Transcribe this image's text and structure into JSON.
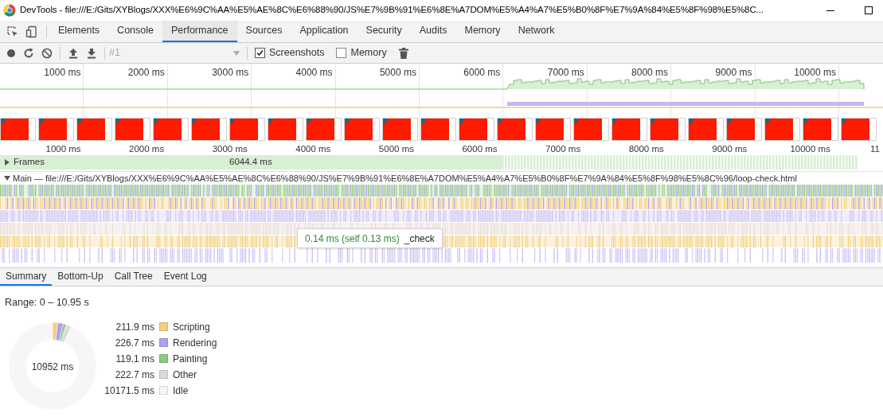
{
  "window": {
    "title": "DevTools - file:///E:/Gits/XYBlogs/XXX%E6%9C%AA%E5%AE%8C%E6%88%90/JS%E7%9B%91%E6%8E%A7DOM%E5%A4%A7%E5%B0%8F%E7%9A%84%E5%8F%98%E5%8C..."
  },
  "tabs": [
    {
      "label": "Elements",
      "selected": false
    },
    {
      "label": "Console",
      "selected": false
    },
    {
      "label": "Performance",
      "selected": true
    },
    {
      "label": "Sources",
      "selected": false
    },
    {
      "label": "Application",
      "selected": false
    },
    {
      "label": "Security",
      "selected": false
    },
    {
      "label": "Audits",
      "selected": false
    },
    {
      "label": "Memory",
      "selected": false
    },
    {
      "label": "Network",
      "selected": false
    }
  ],
  "toolbar": {
    "recording_select": {
      "placeholder": "#1"
    },
    "checkboxes": [
      {
        "label": "Screenshots",
        "checked": true
      },
      {
        "label": "Memory",
        "checked": false
      }
    ]
  },
  "overview": {
    "ticks": [
      "1000 ms",
      "2000 ms",
      "3000 ms",
      "4000 ms",
      "5000 ms",
      "6000 ms",
      "7000 ms",
      "8000 ms",
      "9000 ms",
      "10000 ms"
    ]
  },
  "ruler": {
    "ticks": [
      "1000 ms",
      "2000 ms",
      "3000 ms",
      "4000 ms",
      "5000 ms",
      "6000 ms",
      "7000 ms",
      "8000 ms",
      "9000 ms",
      "10000 ms"
    ],
    "cut_label": "11"
  },
  "frames": {
    "label": "Frames",
    "duration": "6044.4 ms",
    "expanded": false
  },
  "main": {
    "label": "Main — file:///E:/Gits/XYBlogs/XXX%E6%9C%AA%E5%AE%8C%E6%88%90/JS%E7%9B%91%E6%8E%A7DOM%E5%A4%A7%E5%B0%8F%E7%9A%84%E5%8F%98%E5%8C%96/loop-check.html",
    "expanded": true
  },
  "tooltip": {
    "duration": "0.14 ms (self 0.13 ms)",
    "name": "_check"
  },
  "details_tabs": [
    {
      "label": "Summary",
      "selected": true
    },
    {
      "label": "Bottom-Up",
      "selected": false
    },
    {
      "label": "Call Tree",
      "selected": false
    },
    {
      "label": "Event Log",
      "selected": false
    }
  ],
  "summary": {
    "range": "Range: 0 – 10.95 s",
    "total": "10952 ms",
    "legend": [
      {
        "value": "211.9 ms",
        "color": "#f2d07e"
      },
      {
        "value": "226.7 ms",
        "color": "#b09ff0"
      },
      {
        "value": "119.1 ms",
        "color": "#8dc784"
      },
      {
        "value": "222.7 ms",
        "color": "#dadada"
      },
      {
        "value": "10171.5 ms",
        "color": "#f6f6f6"
      }
    ],
    "chart_data": {
      "type": "donut",
      "categories": [
        "Scripting",
        "Rendering",
        "Painting",
        "Other",
        "Idle"
      ],
      "values": [
        1.93,
        2.07,
        1.09,
        2.03,
        92.88
      ]
    }
  }
}
